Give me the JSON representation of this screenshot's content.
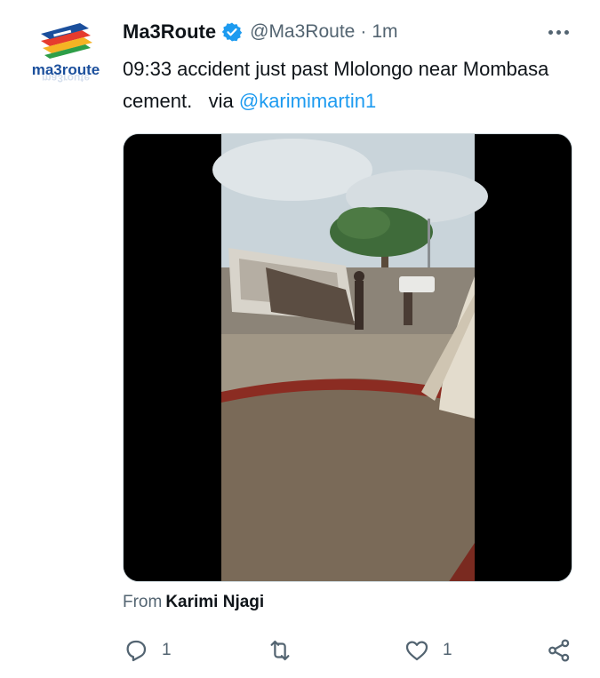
{
  "tweet": {
    "display_name": "Ma3Route",
    "handle": "@Ma3Route",
    "separator": "·",
    "time": "1m",
    "text_main": "09:33 accident just past Mlolongo near Mombasa cement.",
    "text_via": "via",
    "mention": "@karimimartin1",
    "avatar_text": "ma3route",
    "from_label": "From",
    "from_author": "Karimi Njagi"
  },
  "actions": {
    "reply_count": "1",
    "retweet_count": "",
    "like_count": "1"
  },
  "icons": {
    "verified": "verified-badge-icon",
    "more": "more-dots-icon",
    "reply": "reply-icon",
    "retweet": "retweet-icon",
    "like": "heart-icon",
    "share": "share-icon"
  },
  "colors": {
    "link": "#1d9bf0",
    "secondary_text": "#536471",
    "primary_text": "#0f1419",
    "verified": "#1d9bf0"
  }
}
